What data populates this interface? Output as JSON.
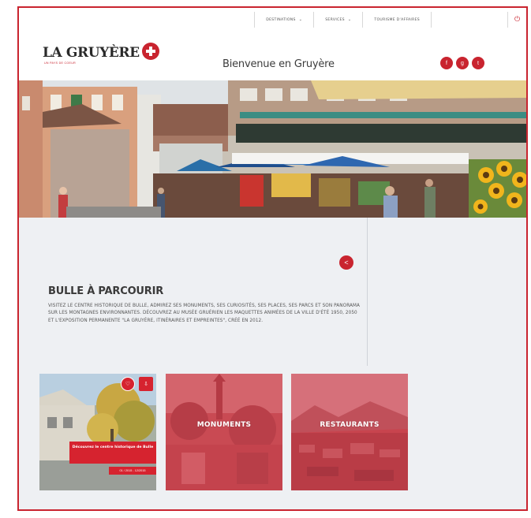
{
  "nav": {
    "items": [
      "DESTINATIONS",
      "SERVICES",
      "TOURISME D'AFFAIRES"
    ],
    "power_icon": "power-icon"
  },
  "header": {
    "logo_text": "LA GRUYÈRE",
    "logo_sub": "UN PAYS DE COEUR",
    "welcome": "Bienvenue en Gruyère",
    "socials": [
      "f",
      "g",
      "t"
    ]
  },
  "section": {
    "title": "BULLE À PARCOURIR",
    "body": "VISITEZ LE CENTRE HISTORIQUE DE BULLE, ADMIREZ SES MONUMENTS, SES CURIOSITÉS, SES PLACES, SES PARCS ET SON PANORAMA SUR LES MONTAGNES ENVIRONNANTES. DÉCOUVREZ AU MUSÉE GRUÉRIEN LES MAQUETTES ANIMÉES DE LA VILLE D'ÉTÉ 1950, 2050 ET L'EXPOSITION PERMANENTE \"LA GRUYÈRE, ITINÉRAIRES ET EMPREINTES\", CRÉÉ EN 2012."
  },
  "cards": [
    {
      "label": "",
      "badge": "Découvrez le centre historique de Bulle",
      "date": "01 / 2015 - 12/2015"
    },
    {
      "label": "MONUMENTS"
    },
    {
      "label": "RESTAURANTS"
    }
  ],
  "colors": {
    "accent": "#c9242f",
    "content_bg": "#eef0f3"
  }
}
